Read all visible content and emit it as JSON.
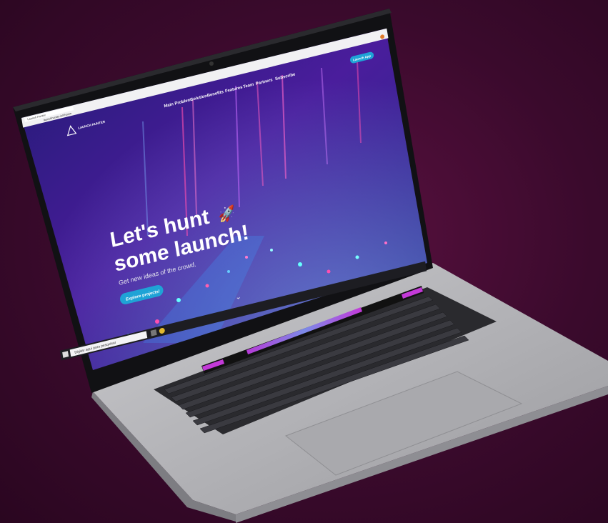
{
  "browser": {
    "tab_title": "Launch Hunter",
    "url": "launchhunter.io/#home"
  },
  "header": {
    "logo_text": "LAUNCH HUNTER",
    "nav_items": [
      "Main Problem",
      "Solution",
      "Benefits",
      "Features",
      "Team",
      "Partners",
      "Subscribe"
    ],
    "cta_label": "Launch App"
  },
  "hero": {
    "title_line1": "Let's hunt",
    "title_line2": "some launch!",
    "subtitle": "Get new ideas of the crowd.",
    "button_label": "Explore projects!"
  },
  "taskbar": {
    "search_placeholder": "Digitar aqui para pesquisar"
  },
  "colors": {
    "background": "#3a0a2c",
    "accent": "#1fa3d6",
    "hero_purple": "#3b1b8c"
  }
}
